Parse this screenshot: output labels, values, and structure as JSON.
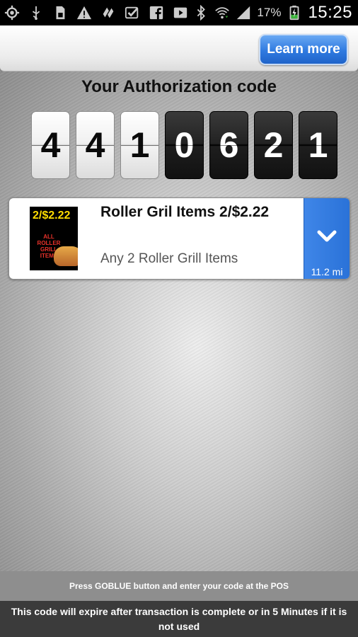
{
  "status_bar": {
    "battery_percent": "17%",
    "time": "15:25",
    "icons": [
      "gps-icon",
      "usb-icon",
      "sd-card-icon",
      "warning-icon",
      "flip-icon",
      "checkbox-icon",
      "facebook-icon",
      "play-store-icon",
      "bluetooth-icon",
      "wifi-icon",
      "signal-icon",
      "battery-charging-icon"
    ]
  },
  "header": {
    "learn_more_label": "Learn more"
  },
  "auth": {
    "title": "Your Authorization code",
    "digits": [
      "4",
      "4",
      "1",
      "0",
      "6",
      "2",
      "1"
    ]
  },
  "offer": {
    "title": "Roller Gril Items 2/$2.22",
    "description": "Any 2 Roller Grill Items",
    "distance": "11.2 mi",
    "thumb_price": "2/$2.22",
    "thumb_text": "ALL ROLLER GRILL ITEMS"
  },
  "footer": {
    "hint": "Press GOBLUE button and enter your code at the POS",
    "expire": "This code will expire after transaction is complete or in 5 Minutes if it is not used"
  },
  "colors": {
    "accent_blue": "#2f7ae0",
    "status_bar": "#000000",
    "expire_bar": "#3b3b3b",
    "hint_bar": "#8e8e8e"
  }
}
